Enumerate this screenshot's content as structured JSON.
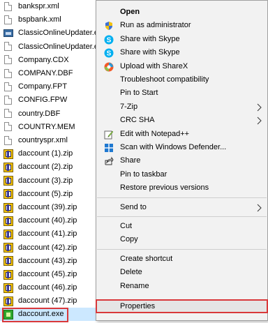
{
  "files": [
    {
      "name": "bankspr.xml",
      "icon": "document-icon"
    },
    {
      "name": "bspbank.xml",
      "icon": "document-icon"
    },
    {
      "name": "ClassicOnlineUpdater.ex",
      "icon": "application-icon"
    },
    {
      "name": "ClassicOnlineUpdater.ex",
      "icon": "document-icon"
    },
    {
      "name": "Company.CDX",
      "icon": "document-icon"
    },
    {
      "name": "COMPANY.DBF",
      "icon": "document-icon"
    },
    {
      "name": "Company.FPT",
      "icon": "document-icon"
    },
    {
      "name": "CONFIG.FPW",
      "icon": "document-icon"
    },
    {
      "name": "country.DBF",
      "icon": "document-icon"
    },
    {
      "name": "COUNTRY.MEM",
      "icon": "document-icon"
    },
    {
      "name": "countryspr.xml",
      "icon": "document-icon"
    },
    {
      "name": "daccount (1).zip",
      "icon": "zip-icon"
    },
    {
      "name": "daccount (2).zip",
      "icon": "zip-icon"
    },
    {
      "name": "daccount (3).zip",
      "icon": "zip-icon"
    },
    {
      "name": "daccount (5).zip",
      "icon": "zip-icon"
    },
    {
      "name": "daccount (39).zip",
      "icon": "zip-icon"
    },
    {
      "name": "daccount (40).zip",
      "icon": "zip-icon"
    },
    {
      "name": "daccount (41).zip",
      "icon": "zip-icon"
    },
    {
      "name": "daccount (42).zip",
      "icon": "zip-icon"
    },
    {
      "name": "daccount (43).zip",
      "icon": "zip-icon"
    },
    {
      "name": "daccount (45).zip",
      "icon": "zip-icon"
    },
    {
      "name": "daccount (46).zip",
      "icon": "zip-icon"
    },
    {
      "name": "daccount (47).zip",
      "icon": "zip-icon"
    },
    {
      "name": "daccount.exe",
      "icon": "exe-icon",
      "selected": true
    }
  ],
  "menu": {
    "items": [
      {
        "label": "Open",
        "bold": true
      },
      {
        "label": "Run as administrator",
        "icon": "shield-icon"
      },
      {
        "label": "Share with Skype",
        "icon": "skype-icon"
      },
      {
        "label": "Share with Skype",
        "icon": "skype-icon"
      },
      {
        "label": "Upload with ShareX",
        "icon": "sharex-icon"
      },
      {
        "label": "Troubleshoot compatibility"
      },
      {
        "label": "Pin to Start"
      },
      {
        "label": "7-Zip",
        "submenu": true
      },
      {
        "label": "CRC SHA",
        "submenu": true
      },
      {
        "label": "Edit with Notepad++",
        "icon": "notepad-plus-plus-icon"
      },
      {
        "label": "Scan with Windows Defender...",
        "icon": "windows-defender-icon"
      },
      {
        "label": "Share",
        "icon": "share-icon"
      },
      {
        "label": "Pin to taskbar"
      },
      {
        "label": "Restore previous versions"
      },
      {
        "separator": true
      },
      {
        "label": "Send to",
        "submenu": true
      },
      {
        "separator": true
      },
      {
        "label": "Cut"
      },
      {
        "label": "Copy"
      },
      {
        "separator": true
      },
      {
        "label": "Create shortcut"
      },
      {
        "label": "Delete"
      },
      {
        "label": "Rename"
      },
      {
        "separator": true
      },
      {
        "label": "Properties",
        "highlighted": true
      }
    ]
  },
  "colors": {
    "selection": "#cce8ff",
    "highlight_outline": "#d9383a",
    "menu_background": "#f2f2f2"
  }
}
